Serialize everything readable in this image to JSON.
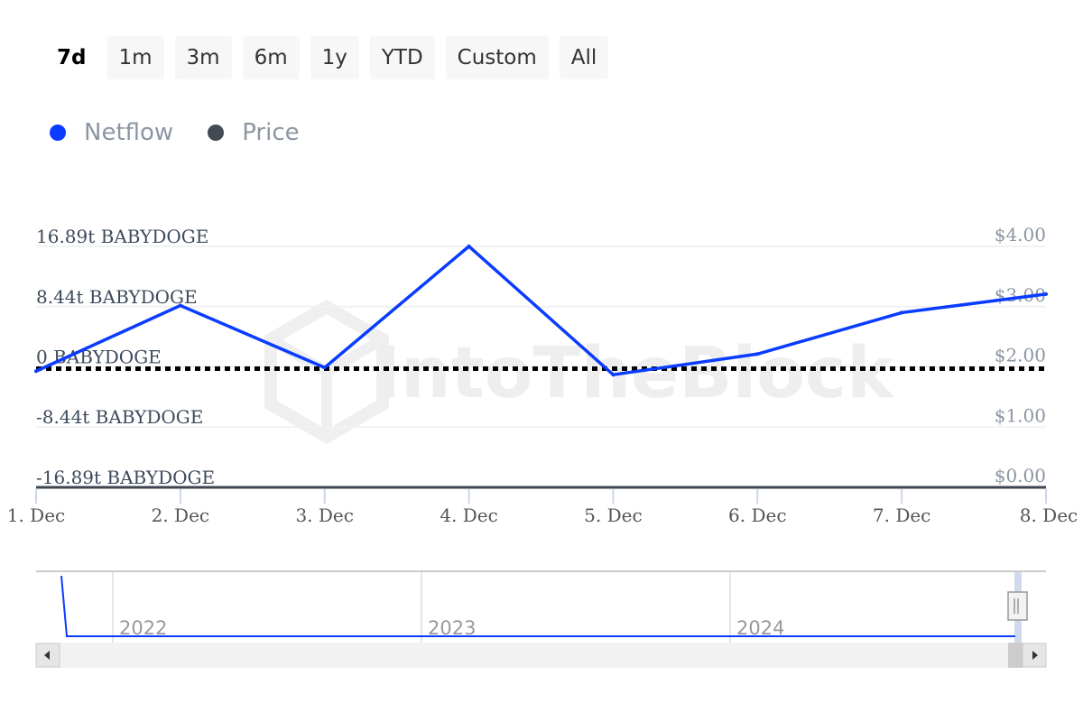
{
  "range_selector": {
    "buttons": [
      {
        "label": "7d",
        "active": true
      },
      {
        "label": "1m",
        "active": false
      },
      {
        "label": "3m",
        "active": false
      },
      {
        "label": "6m",
        "active": false
      },
      {
        "label": "1y",
        "active": false
      },
      {
        "label": "YTD",
        "active": false
      },
      {
        "label": "Custom",
        "active": false
      },
      {
        "label": "All",
        "active": false
      }
    ]
  },
  "legend": {
    "items": [
      {
        "label": "Netflow",
        "color": "#0a3cff"
      },
      {
        "label": "Price",
        "color": "#434a54"
      }
    ]
  },
  "watermark": "IntoTheBlock",
  "chart_data": {
    "type": "line",
    "title": "",
    "xlabel": "",
    "ylabel": "",
    "categories": [
      "1. Dec",
      "2. Dec",
      "3. Dec",
      "4. Dec",
      "5. Dec",
      "6. Dec",
      "7. Dec",
      "8. Dec"
    ],
    "series": [
      {
        "name": "Netflow",
        "unit": "t BABYDOGE",
        "color": "#0a3cff",
        "axis": "left",
        "values": [
          -0.6,
          8.6,
          -0.1,
          16.89,
          -1.1,
          1.8,
          7.6,
          10.2
        ]
      },
      {
        "name": "Price",
        "color": "#000000",
        "axis": "right",
        "style": "dotted",
        "values": [
          1.97,
          1.97,
          1.97,
          1.97,
          1.97,
          1.97,
          1.97,
          1.97
        ]
      }
    ],
    "y_left": {
      "ticks": [
        "16.89t BABYDOGE",
        "8.44t BABYDOGE",
        "0 BABYDOGE",
        "-8.44t BABYDOGE",
        "-16.89t BABYDOGE"
      ],
      "tick_values": [
        16.89,
        8.44,
        0,
        -8.44,
        -16.89
      ],
      "range": [
        -16.89,
        16.89
      ]
    },
    "y_right": {
      "ticks": [
        "$4.00",
        "$3.00",
        "$2.00",
        "$1.00",
        "$0.00"
      ],
      "tick_values": [
        4,
        3,
        2,
        1,
        0
      ],
      "range": [
        0,
        4
      ]
    },
    "grid": true,
    "legend_position": "top-left",
    "navigator": {
      "year_labels": [
        "2022",
        "2023",
        "2024"
      ]
    }
  }
}
